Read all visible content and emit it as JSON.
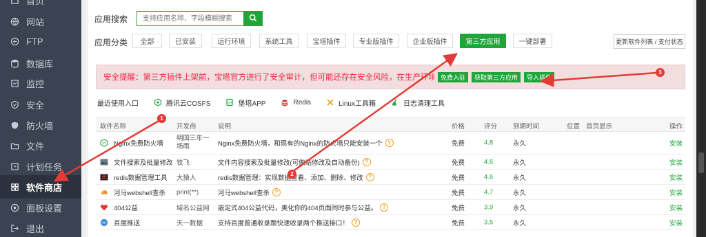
{
  "sidebar": {
    "items": [
      {
        "label": "首页",
        "icon": "home-icon"
      },
      {
        "label": "网站",
        "icon": "globe-icon"
      },
      {
        "label": "FTP",
        "icon": "ftp-icon"
      },
      {
        "label": "数据库",
        "icon": "database-icon"
      },
      {
        "label": "监控",
        "icon": "monitor-icon"
      },
      {
        "label": "安全",
        "icon": "shield-icon"
      },
      {
        "label": "防火墙",
        "icon": "firewall-icon"
      },
      {
        "label": "文件",
        "icon": "folder-icon"
      },
      {
        "label": "计划任务",
        "icon": "clock-icon"
      },
      {
        "label": "软件商店",
        "icon": "grid-icon"
      },
      {
        "label": "面板设置",
        "icon": "settings-icon"
      },
      {
        "label": "退出",
        "icon": "logout-icon"
      }
    ],
    "active_index": 9
  },
  "search": {
    "label": "应用搜索",
    "placeholder": "支持应用名称、字段模糊搜索"
  },
  "categories": {
    "label": "应用分类",
    "items": [
      "全部",
      "已安装",
      "运行环境",
      "系统工具",
      "宝塔插件",
      "专业版插件",
      "企业版插件",
      "第三方应用",
      "一键部署"
    ],
    "active_index": 7,
    "update_label": "更新软件列表 / 支付状态"
  },
  "alert": {
    "text": "安全提醒：第三方插件上架前，宝塔官方进行了安全审计，但可能还存在安全风险，在生产环境使用前请自行甄别",
    "buttons": [
      "免费入驻",
      "获取第三方应用",
      "导入插件"
    ]
  },
  "recent": {
    "label": "最近使用入口",
    "items": [
      {
        "label": "腾讯云COSFS",
        "icon": "cloud-icon"
      },
      {
        "label": "堡塔APP",
        "icon": "app-icon"
      },
      {
        "label": "Redis",
        "icon": "redis-icon"
      },
      {
        "label": "Linux工具箱",
        "icon": "tools-icon"
      },
      {
        "label": "日志清理工具",
        "icon": "broom-icon"
      }
    ]
  },
  "table": {
    "headers": {
      "name": "软件名称",
      "developer": "开发商",
      "desc": "说明",
      "price": "价格",
      "score": "评分",
      "expire": "到期时间",
      "position": "位置",
      "home": "首页显示",
      "op": "操作"
    },
    "rows": [
      {
        "name": "Nginx免费防火墙",
        "developer": "明国三年一场雨",
        "desc": "Nginx免费防火墙，和现有的Nginx的防火墙只能安装一个",
        "price": "免费",
        "score": "4.8",
        "expire": "永久",
        "op": "安装",
        "icon": "nginx-icon"
      },
      {
        "name": "文件搜索及批量修改",
        "developer": "牧飞",
        "desc": "文件内容搜索及批量修改(可做站修改及自动备份)",
        "price": "免费",
        "score": "4.6",
        "expire": "永久",
        "op": "安装",
        "icon": "file-search-icon"
      },
      {
        "name": "redis数据管理工具",
        "developer": "大猿人",
        "desc": "redis数据管理：实现数据查看、添加、删除、修改",
        "price": "免费",
        "score": "4.6",
        "expire": "永久",
        "op": "安装",
        "icon": "redis-tool-icon"
      },
      {
        "name": "河马webshell查杀",
        "developer": "print(**)",
        "desc": "河马webshell查杀",
        "price": "免费",
        "score": "4.7",
        "expire": "永久",
        "op": "安装",
        "icon": "hippo-icon"
      },
      {
        "name": "404公益",
        "developer": "域名公益网",
        "desc": "嵌定式404公益代码，美化你的404页面同时参与公益。",
        "price": "免费",
        "score": "3.9",
        "expire": "永久",
        "op": "安装",
        "icon": "heart-icon"
      },
      {
        "name": "百度推送",
        "developer": "天一数据",
        "desc": "支持百度普通收录跟快速收录两个推送接口！",
        "price": "免费",
        "score": "3.5",
        "expire": "永久",
        "op": "安装",
        "icon": "baidu-icon"
      }
    ]
  },
  "annotations": [
    "1",
    "2",
    "3"
  ],
  "colors": {
    "accent": "#20a53a",
    "sidebar": "#3b4352",
    "alert_text": "#e53935",
    "arrow": "#e53935"
  }
}
